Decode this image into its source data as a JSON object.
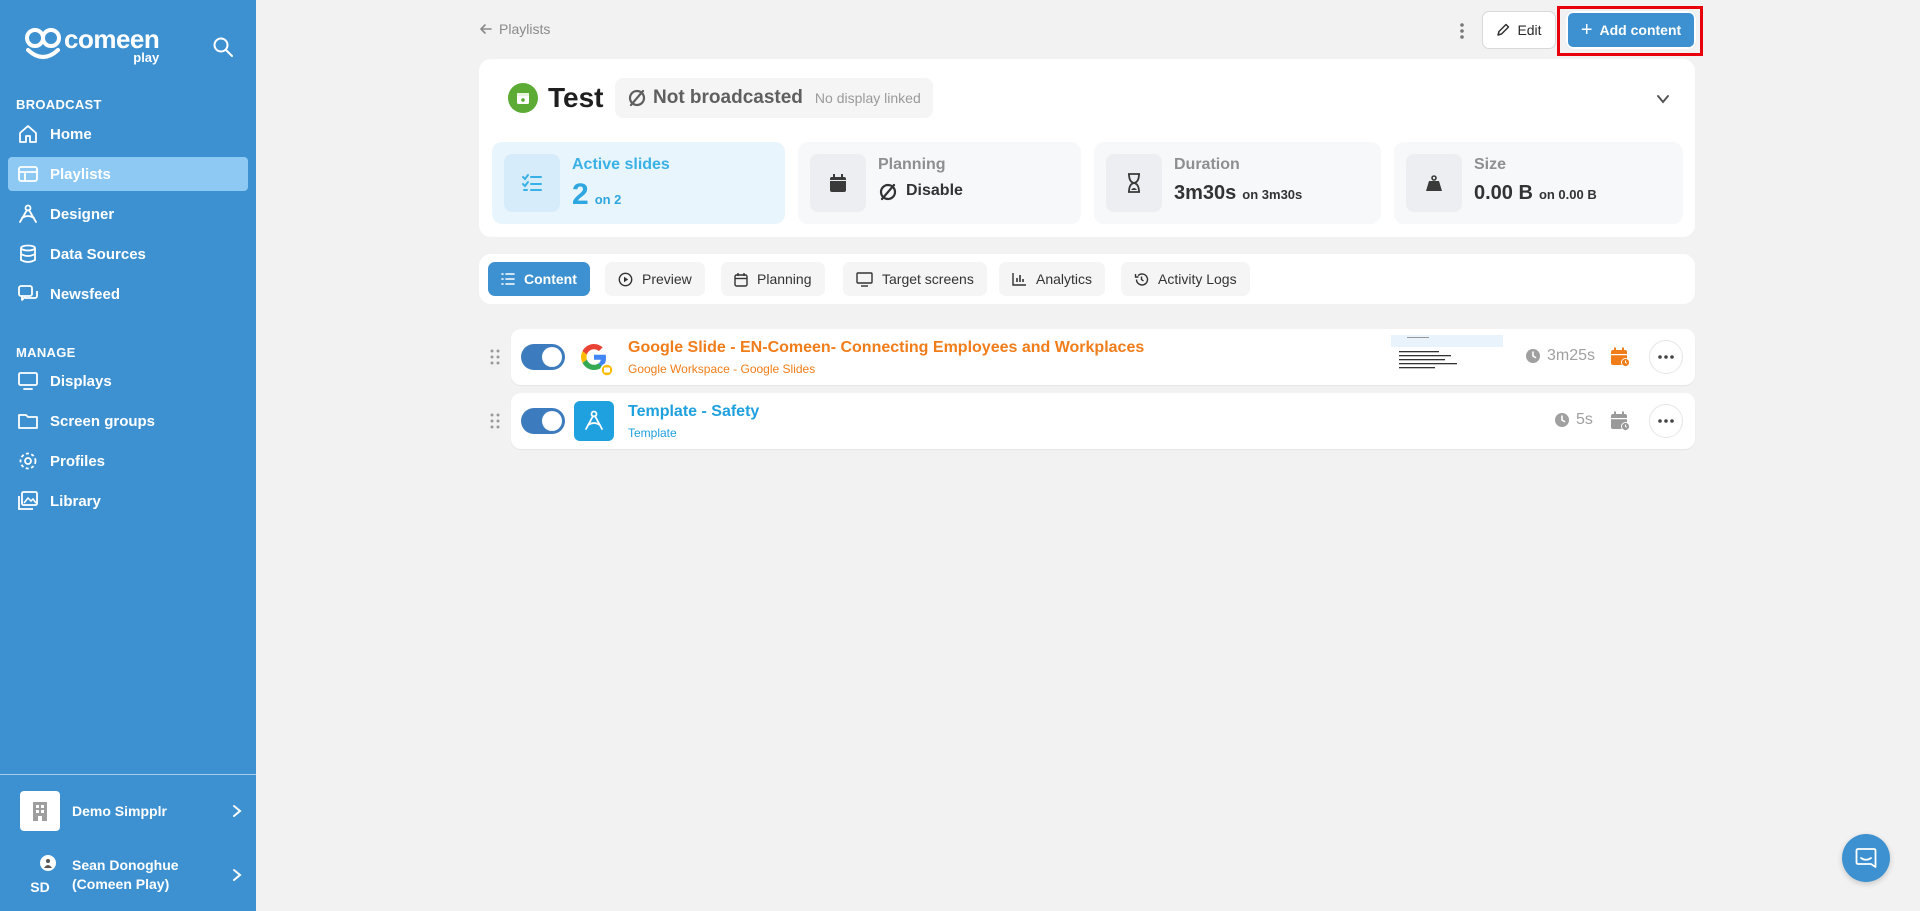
{
  "brand": {
    "name": "comeen",
    "sub": "play"
  },
  "sidebar": {
    "sections": [
      {
        "title": "BROADCAST",
        "items": [
          {
            "label": "Home",
            "icon": "home-icon"
          },
          {
            "label": "Playlists",
            "icon": "playlist-icon",
            "active": true
          },
          {
            "label": "Designer",
            "icon": "designer-icon"
          },
          {
            "label": "Data Sources",
            "icon": "database-icon"
          },
          {
            "label": "Newsfeed",
            "icon": "newsfeed-icon"
          }
        ]
      },
      {
        "title": "MANAGE",
        "items": [
          {
            "label": "Displays",
            "icon": "monitor-icon"
          },
          {
            "label": "Screen groups",
            "icon": "folder-icon"
          },
          {
            "label": "Profiles",
            "icon": "gear-icon"
          },
          {
            "label": "Library",
            "icon": "images-icon"
          }
        ]
      }
    ],
    "organization": "Demo Simpplr",
    "user": {
      "initials": "SD",
      "name_line1": "Sean Donoghue",
      "name_line2": "(Comeen Play)"
    }
  },
  "header": {
    "breadcrumb": "Playlists",
    "edit_label": "Edit",
    "add_label": "Add content"
  },
  "playlist": {
    "title": "Test",
    "broadcast_status": "Not broadcasted",
    "display_status": "No display linked",
    "stats": {
      "active_slides": {
        "label": "Active slides",
        "value": "2",
        "suffix": "on 2"
      },
      "planning": {
        "label": "Planning",
        "value": "Disable"
      },
      "duration": {
        "label": "Duration",
        "value": "3m30s",
        "suffix": "on 3m30s"
      },
      "size": {
        "label": "Size",
        "value": "0.00 B",
        "suffix": "on 0.00 B"
      }
    }
  },
  "tabs": [
    {
      "label": "Content",
      "icon": "list-icon",
      "active": true
    },
    {
      "label": "Preview",
      "icon": "play-circle-icon"
    },
    {
      "label": "Planning",
      "icon": "calendar-icon"
    },
    {
      "label": "Target screens",
      "icon": "monitor-icon"
    },
    {
      "label": "Analytics",
      "icon": "chart-icon"
    },
    {
      "label": "Activity Logs",
      "icon": "history-icon"
    }
  ],
  "content_items": [
    {
      "title": "Google Slide - EN-Comeen- Connecting Employees and Workplaces",
      "subtitle": "Google Workspace - Google Slides",
      "duration": "3m25s",
      "enabled": true,
      "color": "#f07d1a",
      "icon": "google-icon"
    },
    {
      "title": "Template - Safety",
      "subtitle": "Template",
      "duration": "5s",
      "enabled": true,
      "color": "#1fa0df",
      "icon": "template-icon"
    }
  ],
  "colors": {
    "sidebar": "#3d91d0",
    "accent": "#3d91d0",
    "highlight": "#e8000b",
    "active_item": "#8ec9f4"
  }
}
